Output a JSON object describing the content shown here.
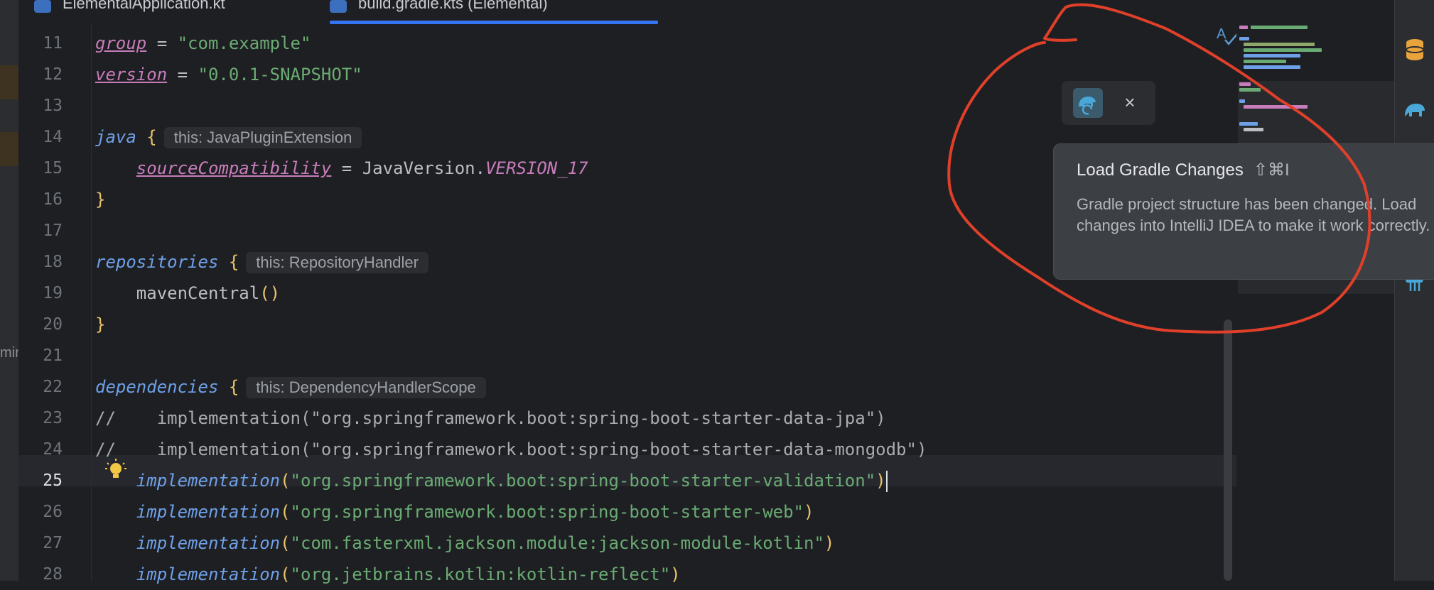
{
  "tabs": [
    {
      "label": "ElementalApplication.kt"
    },
    {
      "label": "build.gradle.kts (Elemental)"
    }
  ],
  "left_strip": {
    "fragment": "mir"
  },
  "editor": {
    "line_numbers": [
      "11",
      "12",
      "13",
      "14",
      "15",
      "16",
      "17",
      "18",
      "19",
      "20",
      "21",
      "22",
      "23",
      "24",
      "25",
      "26",
      "27",
      "28"
    ],
    "active_line": "25",
    "code": {
      "l11": {
        "prop": "group",
        "op": " = ",
        "str": "\"com.example\""
      },
      "l12": {
        "prop": "version",
        "op": " = ",
        "str": "\"0.0.1-SNAPSHOT\""
      },
      "l14": {
        "kw": "java",
        "brace": "{",
        "hint": "this: JavaPluginExtension"
      },
      "l15": {
        "indent": "    ",
        "prop": "sourceCompatibility",
        "op": " = JavaVersion.",
        "const": "VERSION_17"
      },
      "l16": {
        "brace": "}"
      },
      "l18": {
        "kw": "repositories",
        "brace": "{",
        "hint": "this: RepositoryHandler"
      },
      "l19": {
        "text": "    mavenCentral",
        "paren": "()"
      },
      "l20": {
        "brace": "}"
      },
      "l22": {
        "kw": "dependencies",
        "brace": "{",
        "hint": "this: DependencyHandlerScope"
      },
      "l23": {
        "comment": "//    implementation(\"org.springframework.boot:spring-boot-starter-data-jpa\")"
      },
      "l24": {
        "comment": "//    implementation(\"org.springframework.boot:spring-boot-starter-data-mongodb\")"
      },
      "l25": {
        "kw": "implementation",
        "open": "(",
        "str": "\"org.springframework.boot:spring-boot-starter-validation\"",
        "close": ")"
      },
      "l26": {
        "kw": "implementation",
        "open": "(",
        "str": "\"org.springframework.boot:spring-boot-starter-web\"",
        "close": ")"
      },
      "l27": {
        "kw": "implementation",
        "open": "(",
        "str": "\"com.fasterxml.jackson.module:jackson-module-kotlin\"",
        "close": ")"
      },
      "l28": {
        "kw": "implementation",
        "open": "(",
        "str": "\"org.jetbrains.kotlin:kotlin-reflect\"",
        "close": ")"
      }
    }
  },
  "gradle_popup": {
    "close_label": "×",
    "icon": "gradle-reload-icon"
  },
  "tooltip": {
    "title": "Load Gradle Changes",
    "shortcut": "⇧⌘I",
    "body": "Gradle project structure has been changed. Load changes into IntelliJ IDEA to make it work correctly."
  },
  "colors": {
    "annotation": "#e0402a",
    "accent": "#3574f0",
    "keyword": "#6ea0e8",
    "string": "#6aab73",
    "property": "#c77dbb",
    "brace": "#e9c46a"
  }
}
